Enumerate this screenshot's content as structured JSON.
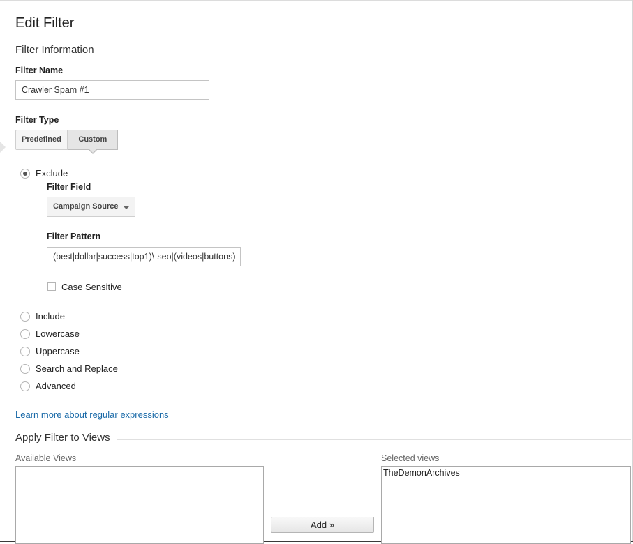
{
  "page": {
    "title": "Edit Filter"
  },
  "filter_info": {
    "section_title": "Filter Information",
    "filter_name_label": "Filter Name",
    "filter_name_value": "Crawler Spam #1",
    "filter_type_label": "Filter Type",
    "type_buttons": {
      "predefined": "Predefined",
      "custom": "Custom"
    },
    "selected_type": "Custom"
  },
  "options": {
    "exclude": "Exclude",
    "include": "Include",
    "lowercase": "Lowercase",
    "uppercase": "Uppercase",
    "search_replace": "Search and Replace",
    "advanced": "Advanced",
    "selected": "Exclude"
  },
  "exclude_settings": {
    "filter_field_label": "Filter Field",
    "filter_field_value": "Campaign Source",
    "filter_pattern_label": "Filter Pattern",
    "filter_pattern_value": "(best|dollar|success|top1)\\-seo|(videos|buttons)",
    "case_sensitive_label": "Case Sensitive",
    "case_sensitive_checked": false
  },
  "learn_more_link": "Learn more about regular expressions",
  "apply_views": {
    "section_title": "Apply Filter to Views",
    "available_label": "Available Views",
    "available_items": [],
    "selected_label": "Selected views",
    "selected_items": [
      "TheDemonArchives"
    ],
    "add_button": "Add »"
  }
}
